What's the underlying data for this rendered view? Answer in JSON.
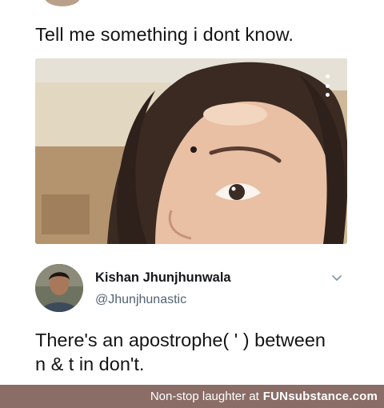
{
  "tweet": {
    "text": "Tell me something i dont know."
  },
  "reply": {
    "name": "Kishan Jhunjhunwala",
    "handle": "@Jhunjhunastic",
    "text_line1": "There's an apostrophe( ' ) between",
    "text_line2": "n & t in don't."
  },
  "footer": {
    "caption": "Non-stop laughter at",
    "brand": "FUNsubstance.com"
  },
  "icons": {
    "more": "more-vertical-icon",
    "chevron": "chevron-down-icon"
  },
  "colors": {
    "footer_bg": "#8a6d66",
    "handle": "#536471"
  }
}
